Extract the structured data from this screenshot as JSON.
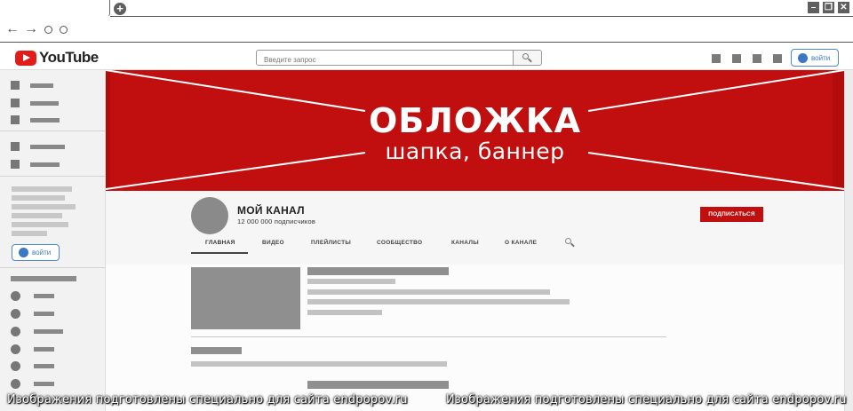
{
  "browser": {
    "new_tab_icon": "plus-icon",
    "window_buttons": [
      "minimize-icon",
      "restore-icon",
      "close-icon"
    ],
    "nav_icons": [
      "back-arrow-icon",
      "forward-arrow-icon",
      "reload-icon",
      "home-icon"
    ]
  },
  "header": {
    "logo_text": "YouTube",
    "search_placeholder": "Введите запрос",
    "login_label": "войти",
    "colors": {
      "brand_red": "#c10e0e",
      "accent_blue": "#3b78c4"
    }
  },
  "sidebar": {
    "login_label": "войти"
  },
  "banner": {
    "title": "ОБЛОЖКА",
    "subtitle": "шапка, баннер"
  },
  "channel": {
    "name": "МОЙ КАНАЛ",
    "subscribers": "12 000 000 подписчиков",
    "subscribe_label": "ПОДПИСАТЬСЯ",
    "tabs": [
      "ГЛАВНАЯ",
      "ВИДЕО",
      "ПЛЕЙЛИСТЫ",
      "СООБЩЕСТВО",
      "КАНАЛЫ",
      "О КАНАЛЕ"
    ],
    "active_tab": "ГЛАВНАЯ"
  },
  "watermark": {
    "text": "Изображения подготовлены специально для сайта endpopov.ru"
  }
}
